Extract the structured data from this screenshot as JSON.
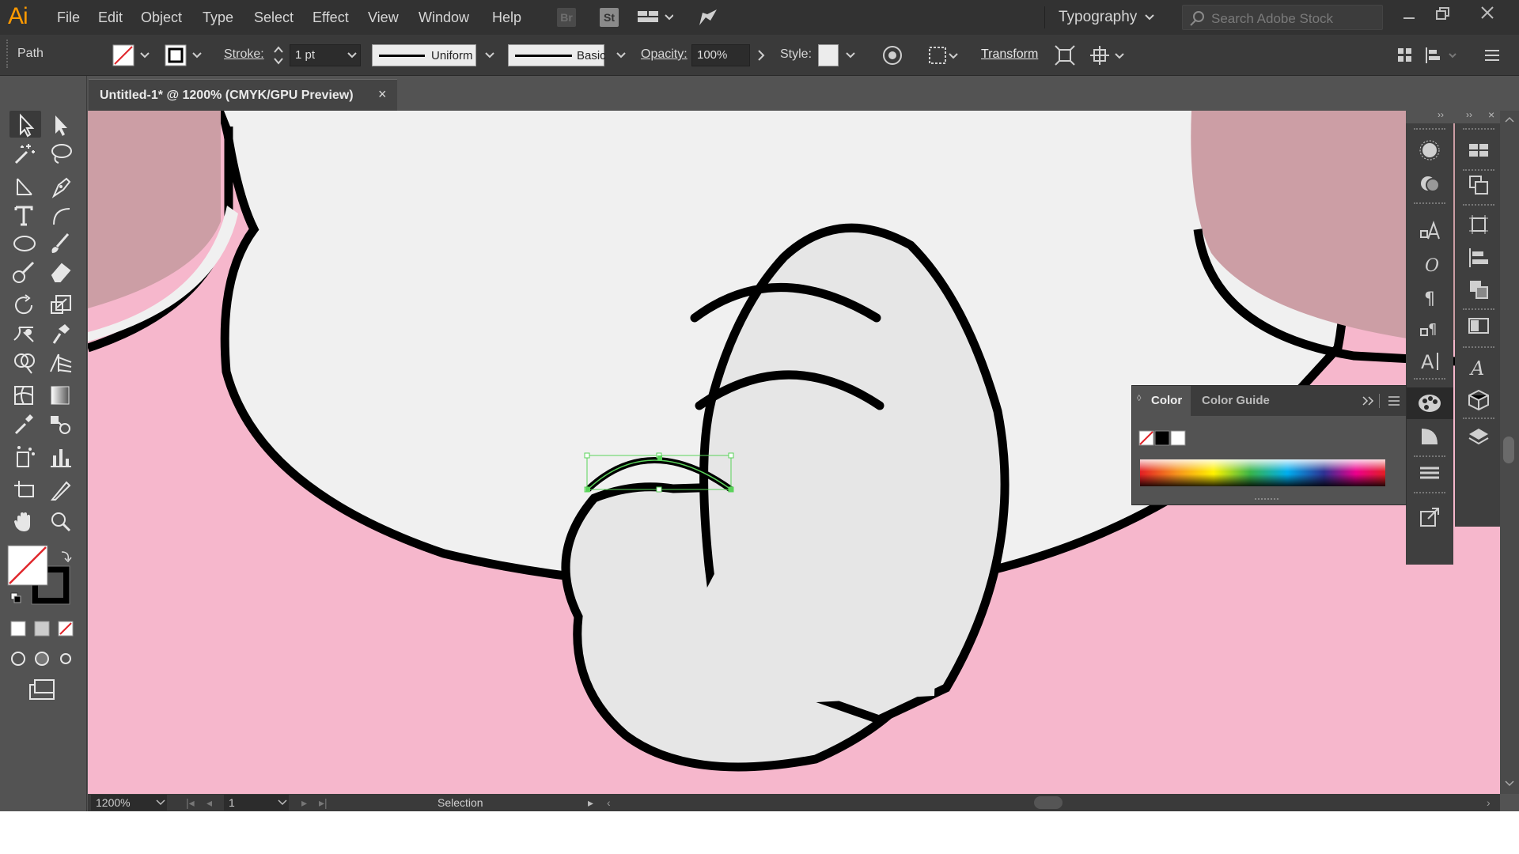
{
  "app": {
    "logo": "Ai"
  },
  "menu": [
    "File",
    "Edit",
    "Object",
    "Type",
    "Select",
    "Effect",
    "View",
    "Window",
    "Help"
  ],
  "menubar_icons": {
    "bridge": "Br",
    "stock": "St"
  },
  "workspace": {
    "label": "Typography"
  },
  "search": {
    "placeholder": "Search Adobe Stock"
  },
  "control_bar": {
    "selection_type": "Path",
    "stroke_label": "Stroke:",
    "stroke_weight": "1 pt",
    "profile_label": "Uniform",
    "brush_label": "Basic",
    "opacity_label": "Opacity:",
    "opacity_value": "100%",
    "style_label": "Style:",
    "transform_label": "Transform"
  },
  "document_tab": {
    "title": "Untitled-1* @ 1200% (CMYK/GPU Preview)",
    "close": "×"
  },
  "color_panel": {
    "tab_color": "Color",
    "tab_color_guide": "Color Guide"
  },
  "status": {
    "zoom": "1200%",
    "artboard": "1",
    "tool": "Selection"
  },
  "colors": {
    "ui_dark": "#323232",
    "ui_mid": "#535353",
    "canvas_pink": "#f6b7cc",
    "face_white": "#f0f0f0",
    "trunk_gray": "#e6e6e6",
    "ear_rose": "#cc9ea5",
    "outline": "#000000",
    "selection_green": "#5ad35a"
  },
  "icons": {
    "tools": [
      "selection-tool",
      "direct-selection-tool",
      "magic-wand-tool",
      "lasso-tool",
      "line-tool",
      "pen-tool",
      "type-tool",
      "arc-tool",
      "ellipse-tool",
      "paintbrush-tool",
      "blob-brush-tool",
      "eraser-tool",
      "rotate-tool",
      "scale-tool",
      "warp-tool",
      "puppet-warp-tool",
      "shape-builder-tool",
      "perspective-grid-tool",
      "mesh-tool",
      "gradient-tool",
      "eyedropper-tool",
      "blend-tool",
      "symbol-sprayer-tool",
      "column-graph-tool",
      "artboard-tool",
      "slice-tool",
      "hand-tool",
      "zoom-tool"
    ]
  }
}
